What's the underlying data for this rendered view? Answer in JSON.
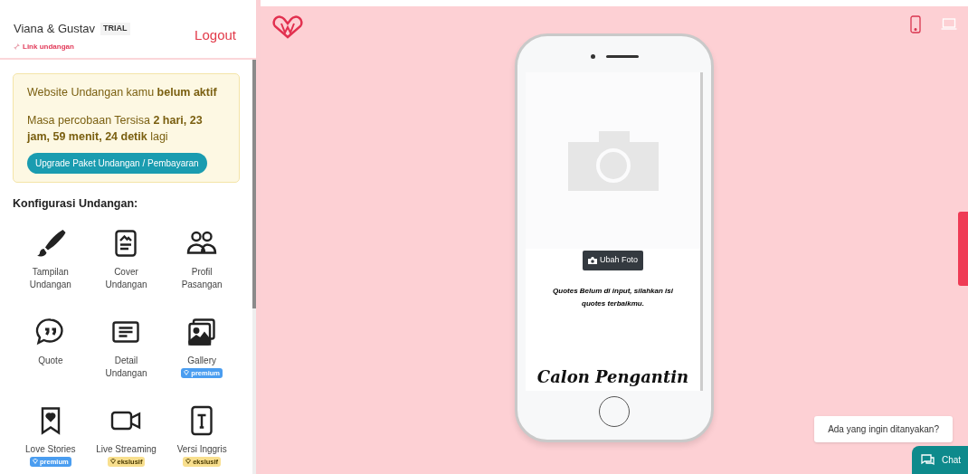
{
  "header": {
    "couple": "Viana & Gustav",
    "plan_badge": "TRIAL",
    "link": "Link undangan",
    "logout": "Logout"
  },
  "notice": {
    "status": "Website Undangan kamu **belum aktif**",
    "trial": "Masa percobaan Tersisa **2 hari, 23 jam, 59 menit, 24 detik** lagi",
    "button": "Upgrade Paket Undangan / Pembayaran"
  },
  "config": {
    "title": "Konfigurasi Undangan:",
    "items": [
      {
        "label": "Tampilan Undangan"
      },
      {
        "label": "Cover Undangan"
      },
      {
        "label": "Profil Pasangan"
      },
      {
        "label": "Quote"
      },
      {
        "label": "Detail Undangan"
      },
      {
        "label": "Gallery",
        "badge": {
          "kind": "premium",
          "text": "premium"
        }
      },
      {
        "label": "Love Stories",
        "badge": {
          "kind": "premium",
          "text": "premium"
        }
      },
      {
        "label": "Live Streaming",
        "badge": {
          "kind": "exclusive",
          "text": "ekslusif"
        }
      },
      {
        "label": "Versi Inggris",
        "badge": {
          "kind": "exclusive",
          "text": "ekslusif"
        }
      }
    ]
  },
  "preview": {
    "devices": [
      {
        "kind": "phone",
        "selected": true
      },
      {
        "kind": "laptop",
        "selected": false
      }
    ],
    "phone": {
      "change_photo": "Ubah Foto",
      "quote": "Quotes Belum di input, silahkan isi quotes terbaikmu.",
      "heading": "Calon Pengantin"
    }
  },
  "chat": {
    "prompt": "Ada yang ingin ditanyakan?",
    "button": "Chat"
  }
}
